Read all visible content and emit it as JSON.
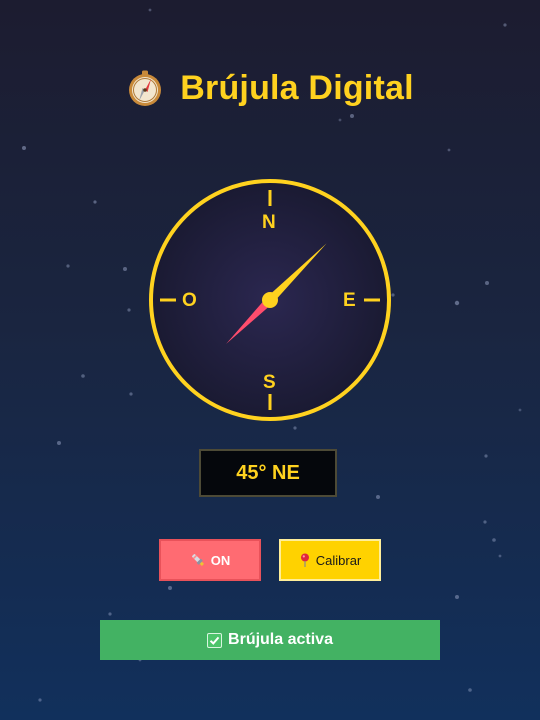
{
  "app": {
    "title": "Brújula Digital",
    "logo_icon": "compass-emoji-icon"
  },
  "compass": {
    "directions": {
      "north": "N",
      "east": "E",
      "south": "S",
      "west": "O"
    },
    "needle_angle_deg": 45,
    "colors": {
      "ring": "#ffd21f",
      "needle_north": "#ffd21f",
      "needle_south": "#ff4d6d",
      "dial": "#25213f"
    }
  },
  "heading": {
    "display": "45° NE"
  },
  "buttons": {
    "toggle": {
      "label": "ON",
      "icon": "flashlight-icon"
    },
    "calibrate": {
      "label": "Calibrar",
      "icon": "pin-icon"
    }
  },
  "status": {
    "text": "Brújula activa",
    "icon": "check-icon",
    "color": "#43b263"
  }
}
